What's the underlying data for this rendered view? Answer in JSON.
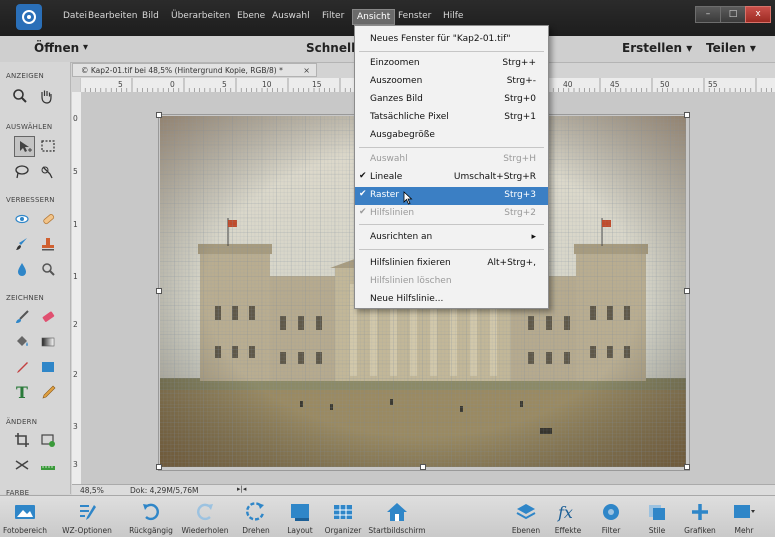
{
  "menubar": {
    "items": [
      "Datei",
      "Bearbeiten",
      "Bild",
      "Überarbeiten",
      "Ebene",
      "Auswahl",
      "Filter",
      "Ansicht",
      "Fenster",
      "Hilfe"
    ],
    "active": "Ansicht",
    "window_controls": {
      "minimize": "–",
      "maximize": "□",
      "close": "x"
    }
  },
  "modebar": {
    "open_label": "Öffnen",
    "open_arrow": "▾",
    "mode_label": "Schnell",
    "create_label": "Erstellen ▾",
    "share_label": "Teilen ▾"
  },
  "panel": {
    "sections": [
      "ANZEIGEN",
      "AUSWÄHLEN",
      "VERBESSERN",
      "ZEICHNEN",
      "ÄNDERN",
      "FARBE"
    ]
  },
  "document": {
    "tab_title": "© Kap2-01.tif bei 48,5% (Hintergrund Kopie, RGB/8) *",
    "tab_close": "×",
    "ruler_h": [
      "5",
      "0",
      "5",
      "10",
      "15",
      "40",
      "45",
      "50",
      "55"
    ],
    "ruler_v": [
      "0",
      "5",
      "1",
      "1",
      "2",
      "2",
      "3",
      "3"
    ]
  },
  "status": {
    "zoom": "48,5%",
    "doc_info": "Dok: 4,29M/5,76M"
  },
  "dropdown": {
    "items": [
      {
        "label": "Neues Fenster für \"Kap2-01.tif\"",
        "shortcut": "",
        "state": "normal"
      },
      {
        "label": "Einzoomen",
        "shortcut": "Strg++",
        "state": "normal"
      },
      {
        "label": "Auszoomen",
        "shortcut": "Strg+-",
        "state": "normal"
      },
      {
        "label": "Ganzes Bild",
        "shortcut": "Strg+0",
        "state": "normal"
      },
      {
        "label": "Tatsächliche Pixel",
        "shortcut": "Strg+1",
        "state": "normal"
      },
      {
        "label": "Ausgabegröße",
        "shortcut": "",
        "state": "normal"
      },
      {
        "label": "Auswahl",
        "shortcut": "Strg+H",
        "state": "disabled"
      },
      {
        "label": "Lineale",
        "shortcut": "Umschalt+Strg+R",
        "state": "checked"
      },
      {
        "label": "Raster",
        "shortcut": "Strg+3",
        "state": "highlighted"
      },
      {
        "label": "Hilfslinien",
        "shortcut": "Strg+2",
        "state": "disabled-checked"
      },
      {
        "label": "Ausrichten an",
        "shortcut": "▸",
        "state": "submenu"
      },
      {
        "label": "Hilfslinien fixieren",
        "shortcut": "Alt+Strg+,",
        "state": "normal"
      },
      {
        "label": "Hilfslinien löschen",
        "shortcut": "",
        "state": "disabled"
      },
      {
        "label": "Neue Hilfslinie...",
        "shortcut": "",
        "state": "normal"
      }
    ],
    "check_mark": "✔"
  },
  "bottombar": {
    "items": [
      {
        "label": "Fotobereich",
        "icon": "photo-bin-icon"
      },
      {
        "label": "WZ-Optionen",
        "icon": "tool-options-icon"
      },
      {
        "label": "Rückgängig",
        "icon": "undo-icon"
      },
      {
        "label": "Wiederholen",
        "icon": "redo-icon"
      },
      {
        "label": "Drehen",
        "icon": "rotate-icon"
      },
      {
        "label": "Layout",
        "icon": "layout-icon"
      },
      {
        "label": "Organizer",
        "icon": "organizer-icon"
      },
      {
        "label": "Startbildschirm",
        "icon": "home-icon"
      },
      {
        "label": "Ebenen",
        "icon": "layers-icon"
      },
      {
        "label": "Effekte",
        "icon": "fx-icon"
      },
      {
        "label": "Filter",
        "icon": "filter-icon"
      },
      {
        "label": "Stile",
        "icon": "styles-icon"
      },
      {
        "label": "Grafiken",
        "icon": "graphics-plus-icon"
      },
      {
        "label": "Mehr",
        "icon": "more-icon"
      }
    ]
  },
  "colors": {
    "menubar_bg": "#222222",
    "highlight": "#3b7fc4",
    "icon_blue": "#2f86c8"
  }
}
